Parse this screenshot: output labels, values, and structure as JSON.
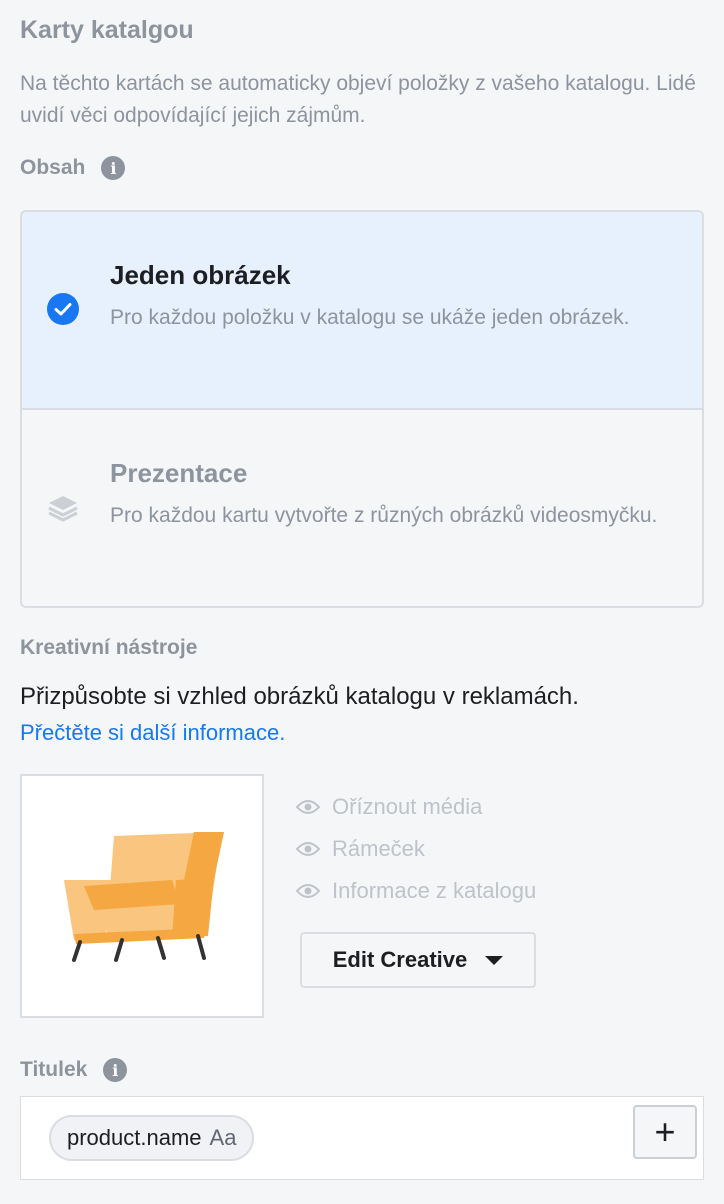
{
  "section": {
    "title": "Karty katalgou",
    "description": "Na těchto kartách se automaticky objeví položky z vašeho katalogu. Lidé uvidí věci odpovídající jejich zájmům."
  },
  "content": {
    "label": "Obsah",
    "info_icon": "i",
    "options": [
      {
        "title": "Jeden obrázek",
        "description": "Pro každou položku v katalogu se ukáže jeden obrázek.",
        "selected": true,
        "icon": "check-circle-icon"
      },
      {
        "title": "Prezentace",
        "description": "Pro každou kartu vytvořte z různých obrázků videosmyčku.",
        "selected": false,
        "icon": "layers-icon"
      }
    ]
  },
  "creative_tools": {
    "label": "Kreativní nástroje",
    "description": "Přizpůsobte si vzhled obrázků katalogu v reklamách.",
    "learn_more": "Přečtěte si další informace.",
    "tools": [
      "Oříznout média",
      "Rámeček",
      "Informace z katalogu"
    ],
    "edit_button": "Edit Creative"
  },
  "headline": {
    "label": "Titulek",
    "info_icon": "i",
    "token": "product.name",
    "token_suffix": "Aa",
    "add_button": "+"
  },
  "colors": {
    "accent": "#1877f2",
    "selected_bg": "#e7f0fd",
    "muted_text": "#8d949e",
    "chair_light": "#f9c57f",
    "chair_dark": "#f5a742"
  }
}
